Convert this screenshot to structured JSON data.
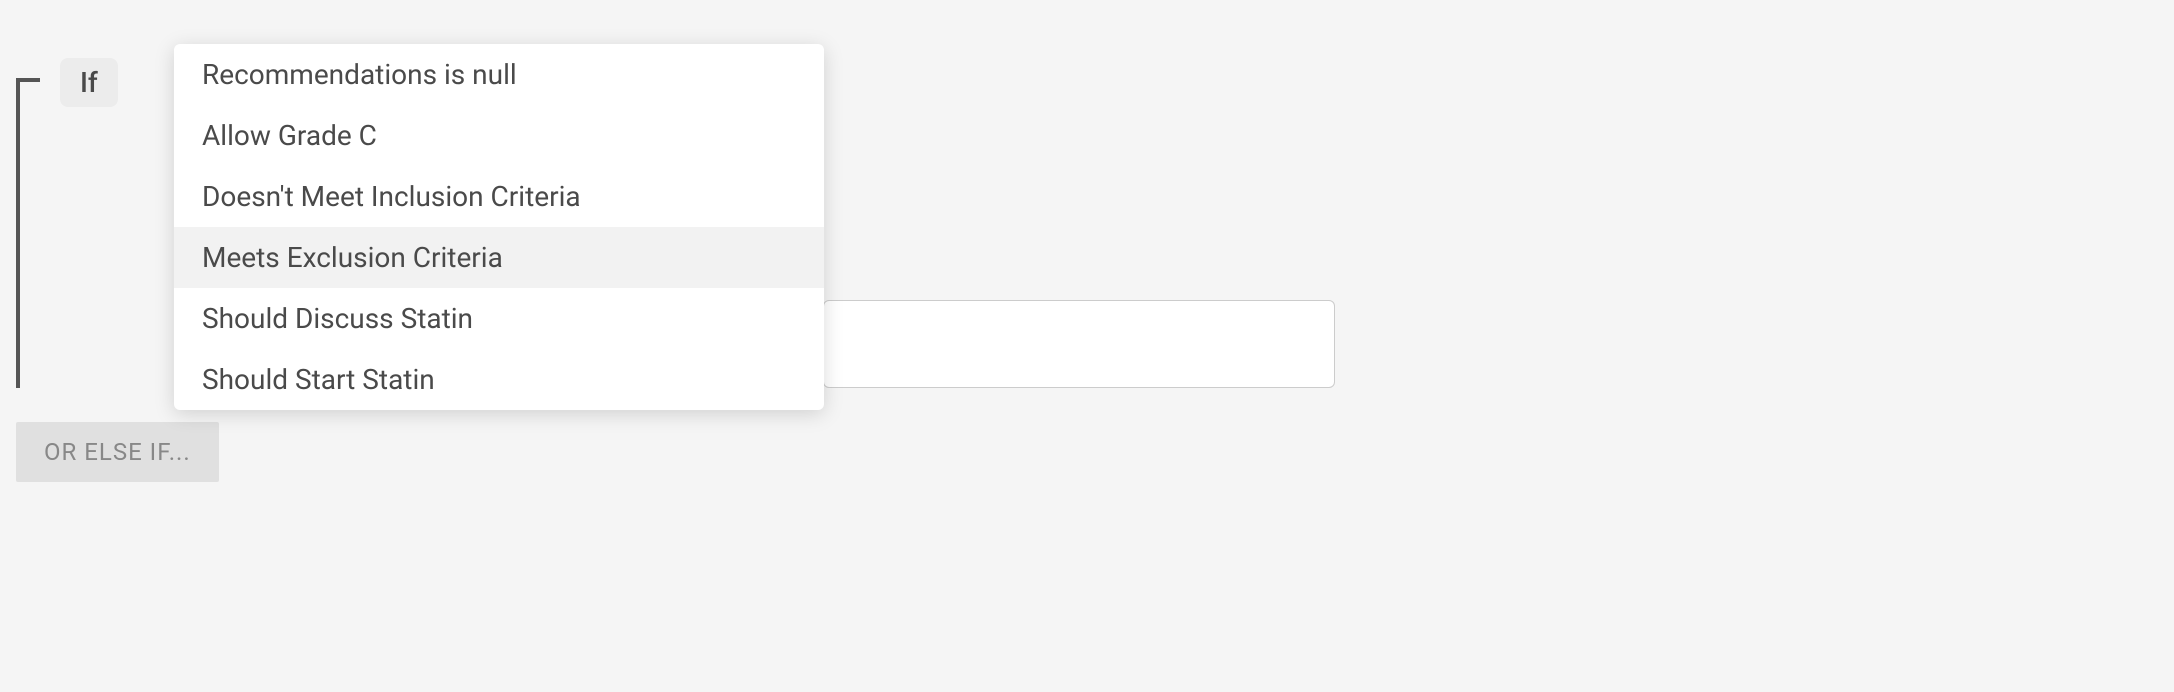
{
  "condition": {
    "if_label": "If",
    "truncated_above": "",
    "dropdown_items": [
      {
        "label": "Recommendations is null",
        "hovered": false
      },
      {
        "label": "Allow Grade C",
        "hovered": false
      },
      {
        "label": "Doesn't Meet Inclusion Criteria",
        "hovered": false
      },
      {
        "label": "Meets Exclusion Criteria",
        "hovered": true
      },
      {
        "label": "Should Discuss Statin",
        "hovered": false
      },
      {
        "label": "Should Start Statin",
        "hovered": false
      }
    ]
  },
  "or_else_label": "OR ELSE IF...",
  "input_value": ""
}
